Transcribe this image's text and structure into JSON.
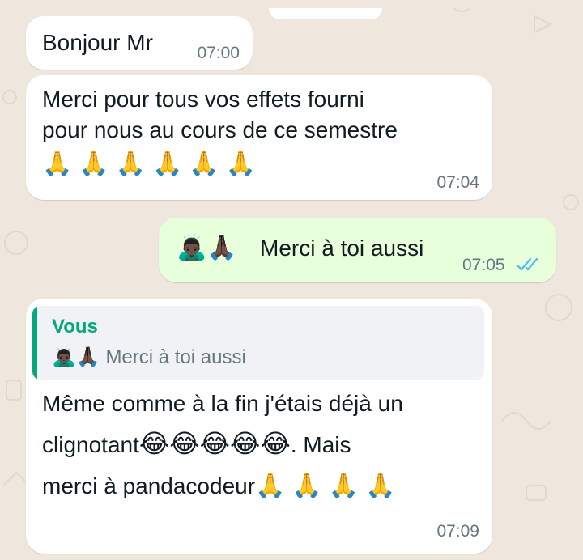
{
  "messages": {
    "m1": {
      "text": "Bonjour Mr",
      "time": "07:00"
    },
    "m2": {
      "line1": "Merci pour tous vos effets fourni",
      "line2": "pour nous au cours de ce semestre",
      "emojis": "🙏🙏🙏🙏🙏🙏",
      "time": "07:04"
    },
    "m3": {
      "emoji_prefix": "🙇🏿‍♂️🙏🏿",
      "text": "Merci à toi aussi",
      "time": "07:05",
      "status": "read"
    },
    "m4": {
      "quote": {
        "author": "Vous",
        "emoji_prefix": "🙇🏿‍♂️🙏🏿",
        "text": "Merci à toi aussi"
      },
      "line1": "Même comme à la fin j'étais déjà un",
      "line2_text": "clignotant",
      "line2_emojis": "😂😂😂😂😂",
      "line2_tail": ". Mais",
      "line3_text": "merci à pandacodeur",
      "line3_emojis": "🙏🙏🙏🙏",
      "time": "07:09"
    }
  },
  "colors": {
    "background": "#efe7dd",
    "incoming_bubble": "#ffffff",
    "outgoing_bubble": "#e7ffdb",
    "quote_accent": "#06a77d",
    "read_ticks": "#53bdeb",
    "timestamp": "#667781"
  },
  "icons": {
    "read_status": "double-check-icon"
  }
}
